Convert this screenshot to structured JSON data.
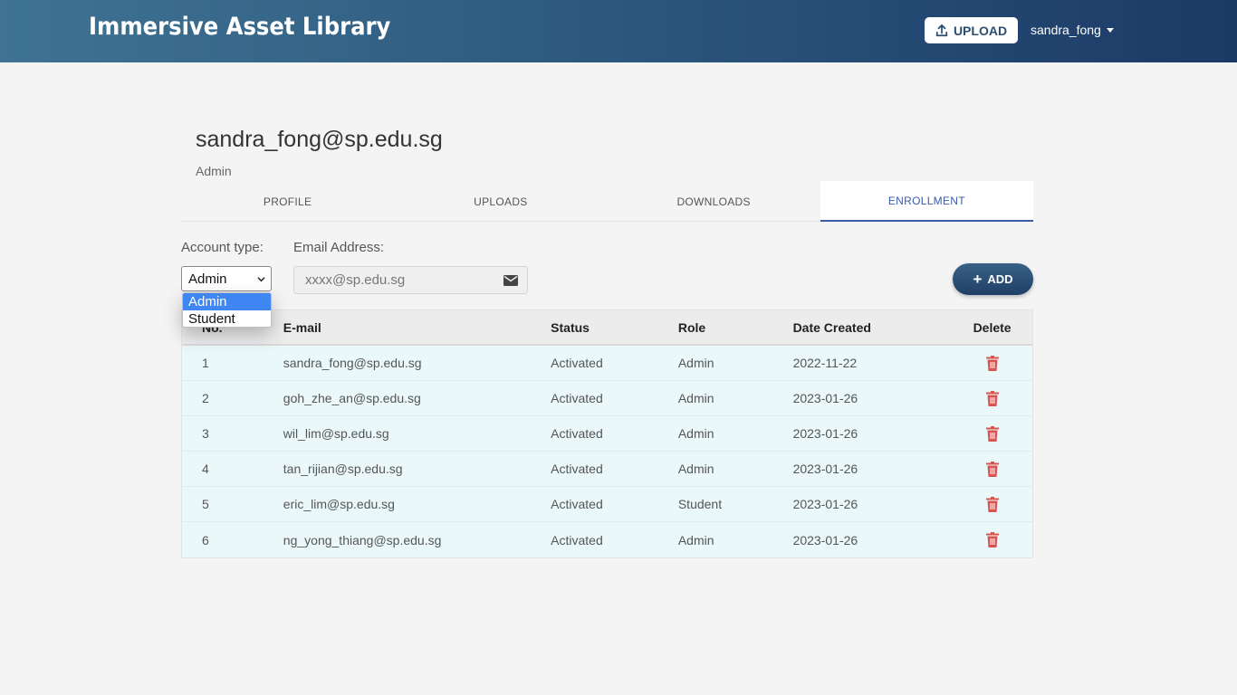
{
  "app": {
    "title": "Immersive Asset Library"
  },
  "header": {
    "upload_label": "UPLOAD",
    "username": "sandra_fong"
  },
  "profile": {
    "email": "sandra_fong@sp.edu.sg",
    "role": "Admin"
  },
  "tabs": [
    {
      "label": "PROFILE",
      "active": false
    },
    {
      "label": "UPLOADS",
      "active": false
    },
    {
      "label": "DOWNLOADS",
      "active": false
    },
    {
      "label": "ENROLLMENT",
      "active": true
    }
  ],
  "form": {
    "account_type_label": "Account type:",
    "account_type_value": "Admin",
    "account_type_options": [
      "Admin",
      "Student"
    ],
    "email_label": "Email Address:",
    "email_placeholder": "xxxx@sp.edu.sg",
    "add_label": "ADD"
  },
  "table": {
    "columns": [
      "No.",
      "E-mail",
      "Status",
      "Role",
      "Date Created",
      "Delete"
    ],
    "rows": [
      {
        "no": "1",
        "email": "sandra_fong@sp.edu.sg",
        "status": "Activated",
        "role": "Admin",
        "date": "2022-11-22"
      },
      {
        "no": "2",
        "email": "goh_zhe_an@sp.edu.sg",
        "status": "Activated",
        "role": "Admin",
        "date": "2023-01-26"
      },
      {
        "no": "3",
        "email": "wil_lim@sp.edu.sg",
        "status": "Activated",
        "role": "Admin",
        "date": "2023-01-26"
      },
      {
        "no": "4",
        "email": "tan_rijian@sp.edu.sg",
        "status": "Activated",
        "role": "Admin",
        "date": "2023-01-26"
      },
      {
        "no": "5",
        "email": "eric_lim@sp.edu.sg",
        "status": "Activated",
        "role": "Student",
        "date": "2023-01-26"
      },
      {
        "no": "6",
        "email": "ng_yong_thiang@sp.edu.sg",
        "status": "Activated",
        "role": "Admin",
        "date": "2023-01-26"
      }
    ]
  },
  "icons": {
    "upload": "upload-icon",
    "mail": "envelope-icon",
    "delete": "trash-icon",
    "add": "plus-icon",
    "caret": "caret-down-icon"
  },
  "colors": {
    "header_start": "#3f7393",
    "header_end": "#1b3a66",
    "active_tab": "#3a5ba8",
    "row_bg": "#eaf8fa",
    "delete_red": "#d9534f",
    "dropdown_selected": "#3f86f2"
  }
}
